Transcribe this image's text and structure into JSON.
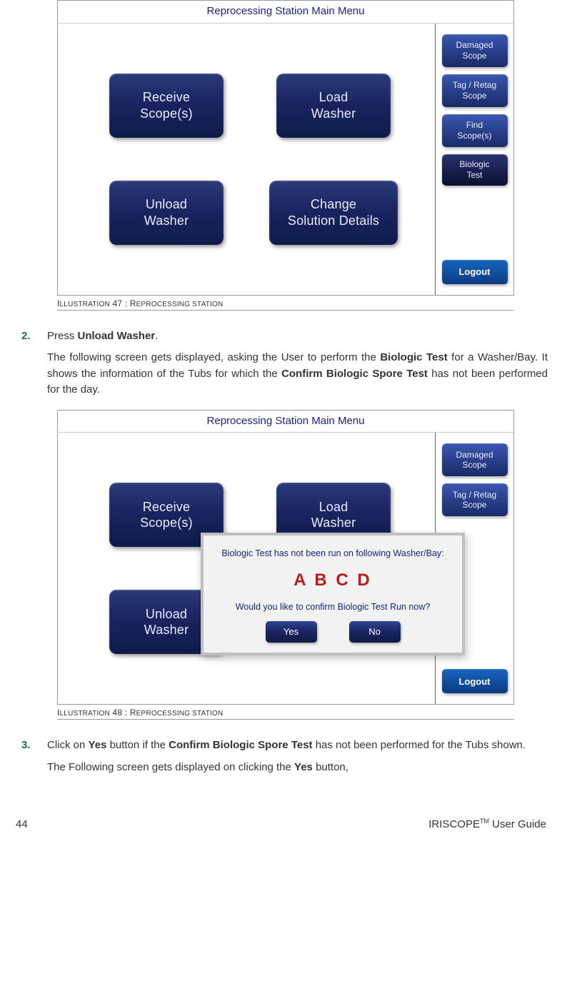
{
  "figure1": {
    "title": "Reprocessing Station Main Menu",
    "main_buttons": {
      "receive": "Receive\nScope(s)",
      "load": "Load\nWasher",
      "unload": "Unload\nWasher",
      "change": "Change\nSolution Details"
    },
    "side_buttons": {
      "damaged": "Damaged\nScope",
      "tag": "Tag / Retag\nScope",
      "find": "Find\nScope(s)",
      "biologic": "Biologic\nTest",
      "logout": "Logout"
    },
    "caption_prefix": "I",
    "caption_text": "LLUSTRATION",
    "caption_num": " 47 : R",
    "caption_suffix": "EPROCESSING STATION"
  },
  "step2": {
    "num": "2.",
    "line1a": "Press ",
    "line1b": "Unload Washer",
    "line1c": ".",
    "para2a": "The following screen gets displayed, asking the User to perform the ",
    "para2b": "Biologic Test",
    "para2c": " for a Washer/Bay. It shows the information of the Tubs for which the ",
    "para2d": "Confirm Biologic Spore Test",
    "para2e": " has not been performed for the day."
  },
  "figure2": {
    "title": "Reprocessing Station Main Menu",
    "dialog": {
      "line1": "Biologic Test has not been run on following Washer/Bay:",
      "bays": "A B C D",
      "line2": "Would you like to confirm Biologic Test Run now?",
      "yes": "Yes",
      "no": "No"
    },
    "caption_prefix": "I",
    "caption_text": "LLUSTRATION",
    "caption_num": " 48 : R",
    "caption_suffix": "EPROCESSING STATION"
  },
  "step3": {
    "num": "3.",
    "line1a": "Click on ",
    "line1b": "Yes",
    "line1c": " button if the ",
    "line1d": "Confirm Biologic Spore Test",
    "line1e": " has not been performed for the Tubs shown.",
    "para2": "The Following screen gets displayed on clicking the ",
    "para2b": "Yes",
    "para2c": " button,"
  },
  "footer": {
    "page": "44",
    "brand_a": "IRISCOPE",
    "brand_tm": "TM",
    "brand_b": " User Guide"
  }
}
